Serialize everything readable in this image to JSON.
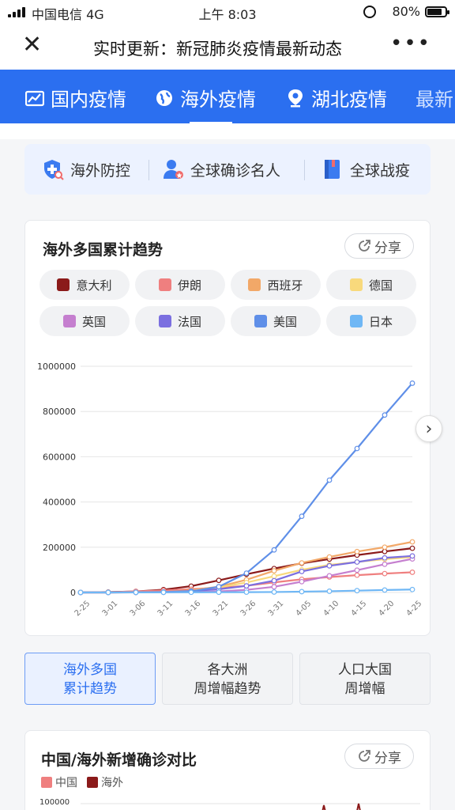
{
  "status_bar": {
    "carrier": "中国电信  4G",
    "time": "上午 8:03",
    "battery": "80%"
  },
  "nav": {
    "title": "实时更新：新冠肺炎疫情最新动态",
    "close_icon": "close-icon",
    "more_icon": "more-icon"
  },
  "tabs": [
    {
      "label": "国内疫情",
      "icon": "chart-icon"
    },
    {
      "label": "海外疫情",
      "icon": "globe-icon"
    },
    {
      "label": "湖北疫情",
      "icon": "location-icon"
    },
    {
      "label": "最新",
      "icon": ""
    }
  ],
  "quick_links": [
    {
      "label": "海外防控",
      "icon": "shield-search-icon"
    },
    {
      "label": "全球确诊名人",
      "icon": "person-star-icon"
    },
    {
      "label": "全球战疫",
      "icon": "book-icon"
    }
  ],
  "trend_card": {
    "title": "海外多国累计趋势",
    "share_label": "分享",
    "legend": [
      {
        "label": "意大利",
        "color": "#8b1a1a"
      },
      {
        "label": "伊朗",
        "color": "#ef7f7f"
      },
      {
        "label": "西班牙",
        "color": "#f2a868"
      },
      {
        "label": "德国",
        "color": "#f8d97c"
      },
      {
        "label": "英国",
        "color": "#c57fcf"
      },
      {
        "label": "法国",
        "color": "#7b6fe0"
      },
      {
        "label": "美国",
        "color": "#5f8fe8"
      },
      {
        "label": "日本",
        "color": "#6fb7f5"
      }
    ]
  },
  "chart_data": {
    "type": "line",
    "x": [
      "2-25",
      "3-01",
      "3-06",
      "3-11",
      "3-16",
      "3-21",
      "3-26",
      "3-31",
      "4-05",
      "4-10",
      "4-15",
      "4-20",
      "4-25"
    ],
    "ylim": [
      0,
      1000000
    ],
    "yticks": [
      0,
      200000,
      400000,
      600000,
      800000,
      1000000
    ],
    "series": [
      {
        "name": "意大利",
        "color": "#8b1a1a",
        "values": [
          322,
          1694,
          4636,
          12462,
          27980,
          53578,
          80589,
          105792,
          128948,
          147577,
          165155,
          181228,
          195351
        ]
      },
      {
        "name": "伊朗",
        "color": "#ef7f7f",
        "values": [
          95,
          978,
          4747,
          9000,
          14991,
          20610,
          29406,
          44605,
          58226,
          68192,
          76389,
          83505,
          89328
        ]
      },
      {
        "name": "西班牙",
        "color": "#f2a868",
        "values": [
          12,
          84,
          401,
          2277,
          9942,
          25374,
          56188,
          95923,
          130759,
          157022,
          180659,
          200210,
          223759
        ]
      },
      {
        "name": "德国",
        "color": "#f8d97c",
        "values": [
          18,
          130,
          670,
          1966,
          7272,
          22364,
          43938,
          71808,
          100123,
          122171,
          134753,
          147065,
          156513
        ]
      },
      {
        "name": "英国",
        "color": "#c57fcf",
        "values": [
          13,
          36,
          164,
          456,
          1543,
          5018,
          11658,
          25150,
          47806,
          73758,
          98476,
          124743,
          148377
        ]
      },
      {
        "name": "法国",
        "color": "#7b6fe0",
        "values": [
          14,
          130,
          613,
          2281,
          6633,
          14459,
          29155,
          52128,
          92839,
          117749,
          134582,
          152894,
          161488
        ]
      },
      {
        "name": "美国",
        "color": "#5f8fe8",
        "values": [
          53,
          75,
          319,
          1301,
          4632,
          25489,
          85356,
          188172,
          336851,
          496535,
          636350,
          784326,
          925038
        ]
      },
      {
        "name": "日本",
        "color": "#6fb7f5",
        "values": [
          170,
          256,
          420,
          620,
          825,
          1046,
          1307,
          1953,
          3654,
          5530,
          8100,
          10797,
          13031
        ]
      }
    ]
  },
  "bottom_tabs": [
    {
      "line1": "海外多国",
      "line2": "累计趋势"
    },
    {
      "line1": "各大洲",
      "line2": "周增幅趋势"
    },
    {
      "line1": "人口大国",
      "line2": "周增幅"
    }
  ],
  "compare_card": {
    "title": "中国/海外新增确诊对比",
    "share_label": "分享",
    "legend": [
      {
        "label": "中国",
        "color": "#ef7f7f"
      },
      {
        "label": "海外",
        "color": "#8b1a1a"
      }
    ],
    "top_tick": "100000"
  }
}
